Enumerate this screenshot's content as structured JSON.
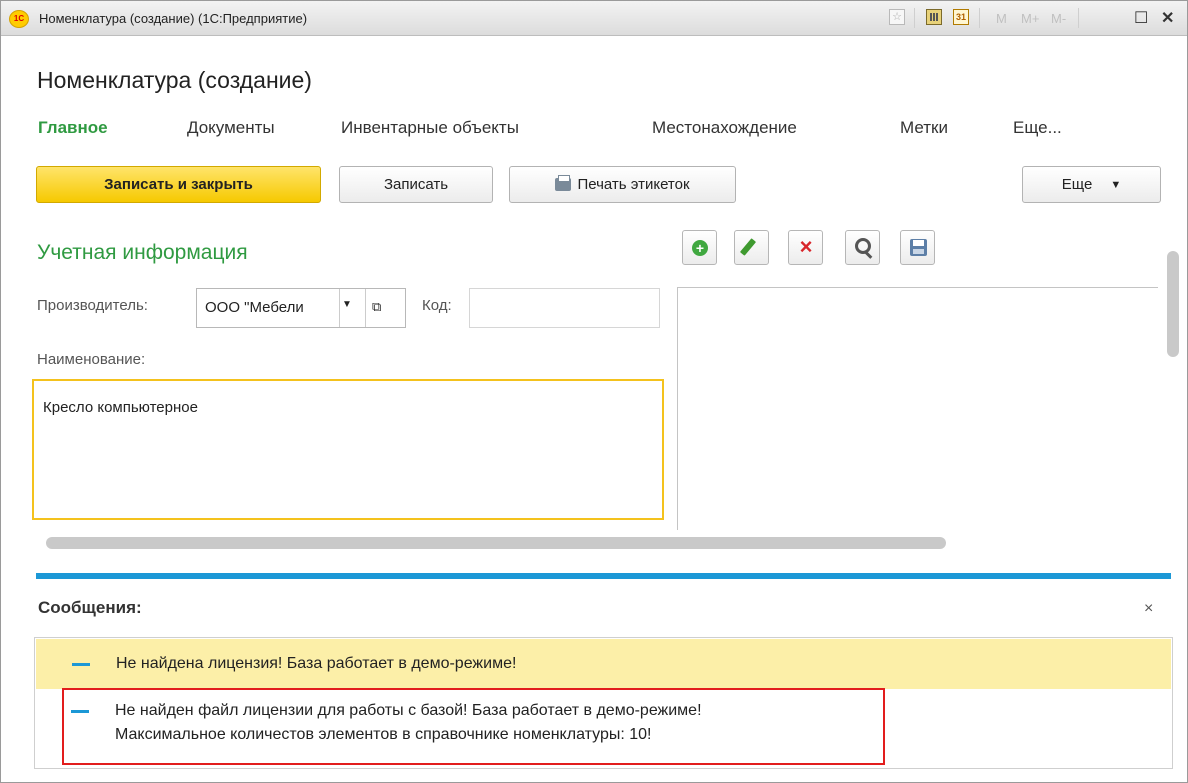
{
  "window": {
    "app_logo": "1C",
    "title": "Номенклатура (создание)  (1С:Предприятие)",
    "toolbar_m": [
      "M",
      "M+",
      "M-"
    ],
    "maximize": "☐",
    "close": "✕"
  },
  "form": {
    "title": "Номенклатура (создание)",
    "tabs": [
      "Главное",
      "Документы",
      "Инвентарные объекты",
      "Местонахождение",
      "Метки",
      "Еще..."
    ],
    "buttons": {
      "save_close": "Записать и закрыть",
      "save": "Записать",
      "print_labels": "Печать этикеток",
      "more": "Еще"
    },
    "section_title": "Учетная информация",
    "manufacturer_label": "Производитель:",
    "manufacturer_value": "ООО \"Мебели",
    "code_label": "Код:",
    "code_value": "",
    "name_label": "Наименование:",
    "name_value": "Кресло компьютерное",
    "image_toolbar_icons": [
      "add-icon",
      "edit-icon",
      "delete-icon",
      "zoom-icon",
      "save-icon"
    ]
  },
  "messages": {
    "title": "Сообщения:",
    "close": "×",
    "items": [
      {
        "line1": "Не найдена лицензия! База работает в демо-режиме!",
        "line2": "",
        "highlighted": true
      },
      {
        "line1": "Не найден файл лицензии для работы с базой! База работает в демо-режиме!",
        "line2": "Максимальное количестов элементов в справочнике номенклатуры: 10!",
        "highlighted": false
      }
    ]
  },
  "colors": {
    "accent_green": "#2f9a41",
    "primary_button": "#f6c900",
    "message_highlight": "#fcefa8",
    "blue_separator": "#1c98d6",
    "annotation_red": "#e21d1d"
  }
}
